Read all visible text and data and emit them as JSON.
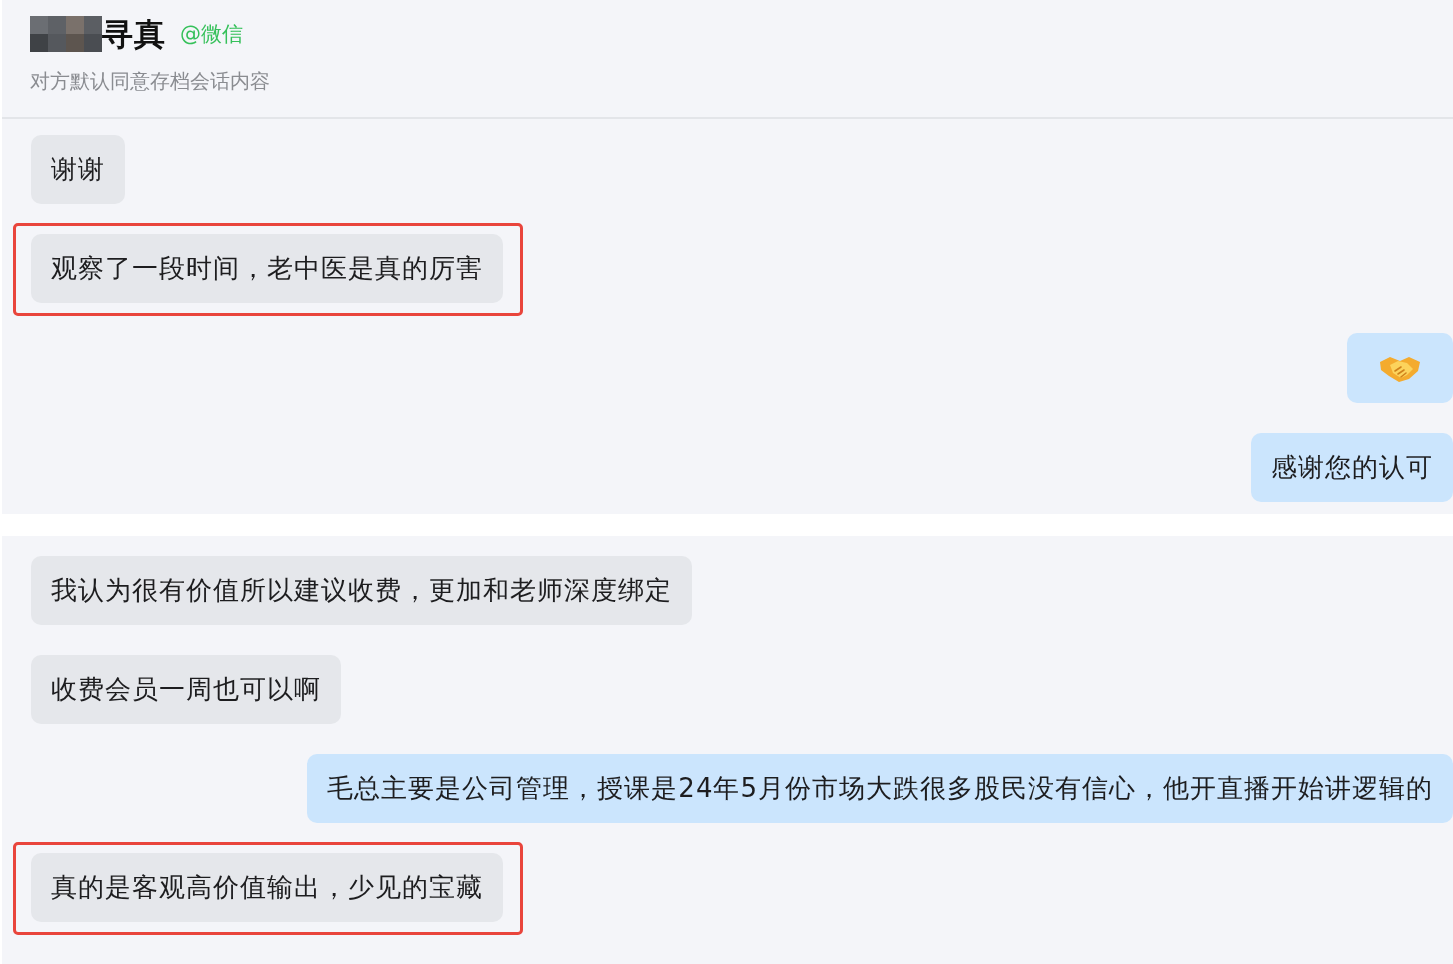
{
  "panels": [
    {
      "header": {
        "redacted": true,
        "name": "寻真",
        "source": "@微信",
        "notice": "对方默认同意存档会话内容"
      },
      "messages": [
        {
          "kind": "text",
          "outgoing": false,
          "highlighted": false,
          "text": "谢谢"
        },
        {
          "kind": "text",
          "outgoing": false,
          "highlighted": true,
          "text": "观察了一段时间，老中医是真的厉害"
        },
        {
          "kind": "emoji",
          "outgoing": true,
          "highlighted": false
        },
        {
          "kind": "text",
          "outgoing": true,
          "highlighted": false,
          "text": "感谢您的认可"
        }
      ]
    },
    {
      "messages": [
        {
          "kind": "text",
          "outgoing": false,
          "highlighted": false,
          "text": "我认为很有价值所以建议收费，更加和老师深度绑定"
        },
        {
          "kind": "text",
          "outgoing": false,
          "highlighted": false,
          "text": "收费会员一周也可以啊"
        },
        {
          "kind": "text",
          "outgoing": true,
          "highlighted": false,
          "text": "毛总主要是公司管理，授课是24年5月份市场大跌很多股民没有信心，他开直播开始讲逻辑的"
        },
        {
          "kind": "text",
          "outgoing": false,
          "highlighted": true,
          "text": "真的是客观高价值输出，少见的宝藏"
        }
      ]
    }
  ]
}
